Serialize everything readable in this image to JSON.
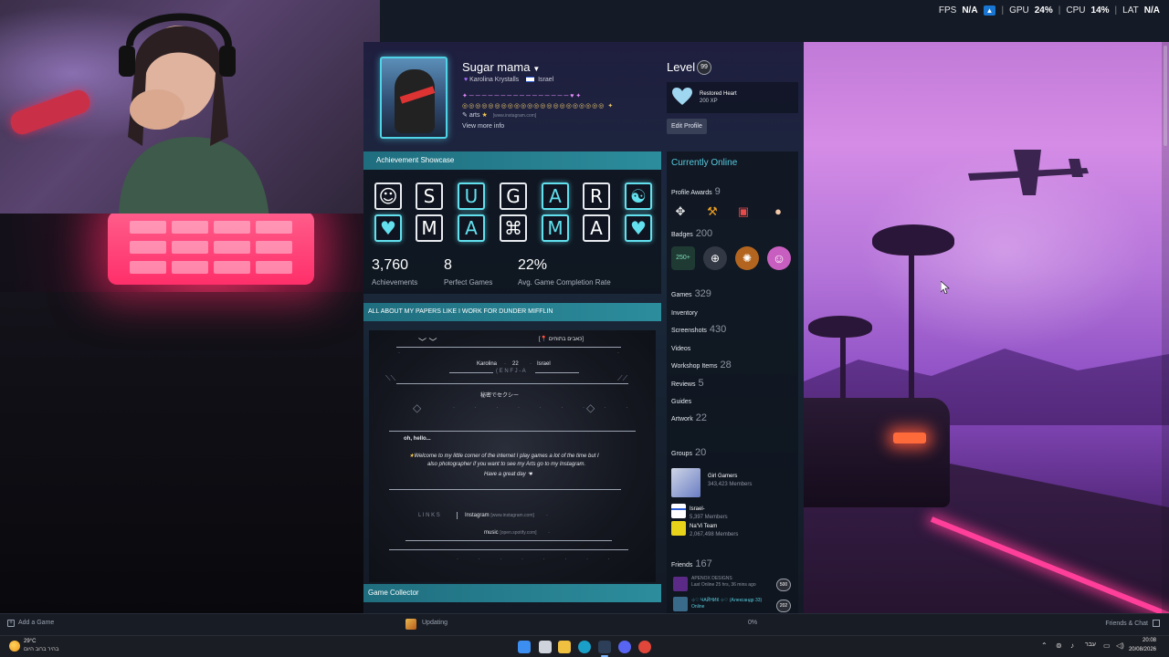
{
  "overlay": {
    "fps_label": "FPS",
    "fps_value": "N/A",
    "gpu_label": "GPU",
    "gpu_value": "24",
    "cpu_label": "CPU",
    "cpu_value": "14",
    "lat_label": "LAT",
    "lat_value": "N/A",
    "pct": "%"
  },
  "profile": {
    "persona_name": "Sugar mama",
    "real_name": "Karolina Krystalls",
    "country": "Israel",
    "summary_arts_label": "arts",
    "summary_url": "[www.instagram.com]",
    "view_more": "View more info",
    "level_label": "Level",
    "level": "99",
    "featured_badge": {
      "name": "Restored Heart",
      "xp": "200 XP"
    },
    "edit_profile": "Edit Profile"
  },
  "achievement_showcase": {
    "header": "Achievement Showcase",
    "tiles_row1": [
      "☺",
      "S",
      "U",
      "G",
      "A",
      "R",
      "☯"
    ],
    "tiles_row2": [
      "♥",
      "M",
      "A",
      "⌘",
      "M",
      "A",
      "♥"
    ],
    "stats": [
      {
        "value": "3,760",
        "label": "Achievements"
      },
      {
        "value": "8",
        "label": "Perfect Games"
      },
      {
        "value": "22%",
        "label": "Avg. Game Completion Rate"
      }
    ]
  },
  "about": {
    "header": "ALL ABOUT MY PAPERS LIKE I WORK FOR DUNDER MIFFLIN",
    "top_right": "[📍 כאבים בתוחים]",
    "name": "Karolina",
    "age": "22",
    "country": "Israel",
    "mbti": "( E N F J - A",
    "jp": "秘密でセクシー",
    "hello": "oh, hello...",
    "welcome1": "Welcome to my little corner of the internet I play games a lot of the time but I",
    "welcome2": "also photographer if you want to see my Arts go to my Instagram.",
    "welcome3": "Have a great day",
    "links_label": "L I N K S",
    "instagram": "Instagram",
    "instagram_url": "[www.instagram.com]",
    "music": "music",
    "music_url": "[open.spotify.com]"
  },
  "game_collector": {
    "header": "Game Collector"
  },
  "sidebar": {
    "currently_online": "Currently Online",
    "profile_awards": {
      "label": "Profile Awards",
      "count": "9"
    },
    "badges": {
      "label": "Badges",
      "count": "200"
    },
    "badge_first": "250+",
    "games": {
      "label": "Games",
      "count": "329"
    },
    "inventory": "Inventory",
    "screenshots": {
      "label": "Screenshots",
      "count": "430"
    },
    "videos": "Videos",
    "workshop": {
      "label": "Workshop Items",
      "count": "28"
    },
    "reviews": {
      "label": "Reviews",
      "count": "5"
    },
    "guides": "Guides",
    "artwork": {
      "label": "Artwork",
      "count": "22"
    },
    "groups": {
      "label": "Groups",
      "count": "20"
    },
    "group_list": [
      {
        "name": "Girl Gamers",
        "members": "343,423 Members"
      },
      {
        "name": "Israel-",
        "members": "5,397 Members"
      },
      {
        "name": "Na'Vi Team",
        "members": "2,067,498 Members"
      }
    ],
    "friends": {
      "label": "Friends",
      "count": "167"
    },
    "friend_list": [
      {
        "name": "APENOX DESIGNS",
        "status": "Last Online 25 hrs, 36 mins ago",
        "level": "500"
      },
      {
        "name": "⊹♡ ЧАЙНИК ⊹♡ (Александр 33)",
        "status": "Online",
        "level": "202"
      }
    ]
  },
  "steam_bottom": {
    "add_game": "Add a Game",
    "updating": "Updating",
    "progress": "0%",
    "friends_chat": "Friends & Chat"
  },
  "taskbar": {
    "temp": "29°C",
    "weather": "בהיר ברוב היום",
    "lang": "עבר",
    "time": "20:08",
    "date": "20/08/2026"
  },
  "colors": {
    "accent_cyan": "#57cbde",
    "showcase_header": "#2c8d9c",
    "neon_pink": "#ff3f9a"
  }
}
